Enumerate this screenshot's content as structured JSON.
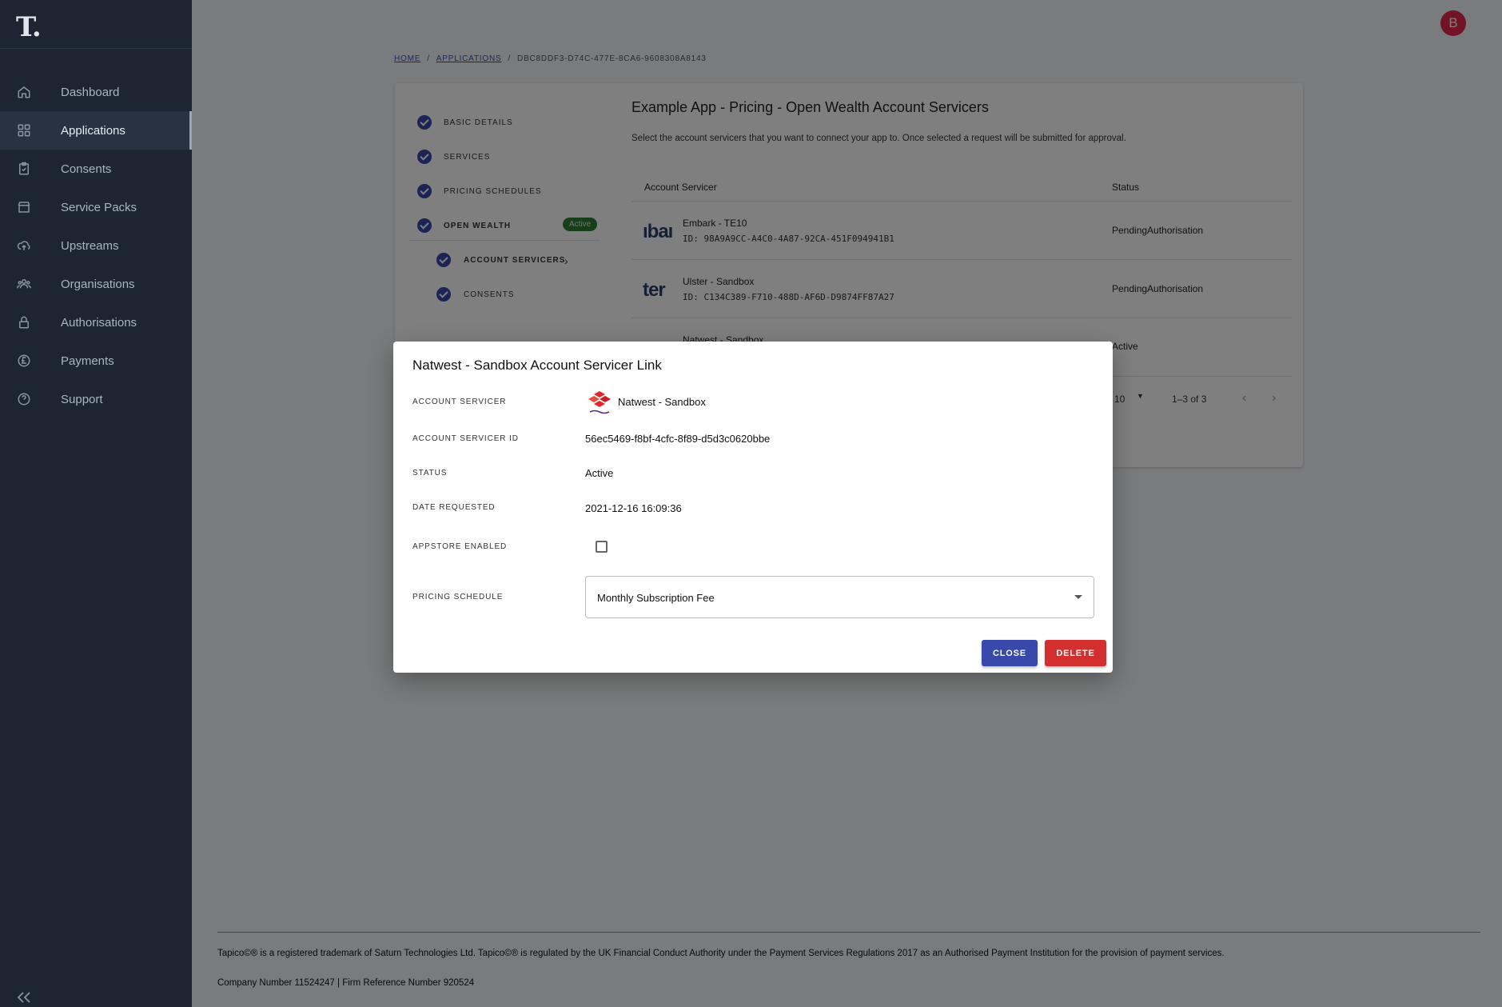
{
  "sidebar": {
    "logo": "T.",
    "items": [
      {
        "label": "Dashboard",
        "icon": "home-icon"
      },
      {
        "label": "Applications",
        "icon": "apps-grid-icon"
      },
      {
        "label": "Consents",
        "icon": "clipboard-check-icon"
      },
      {
        "label": "Service Packs",
        "icon": "store-icon"
      },
      {
        "label": "Upstreams",
        "icon": "cloud-upload-icon"
      },
      {
        "label": "Organisations",
        "icon": "groups-icon"
      },
      {
        "label": "Authorisations",
        "icon": "lock-icon"
      },
      {
        "label": "Payments",
        "icon": "pound-coin-icon"
      },
      {
        "label": "Support",
        "icon": "help-circle-icon"
      }
    ],
    "active_index": 1
  },
  "header": {
    "avatar_initial": "B",
    "avatar_color": "#e0284c"
  },
  "breadcrumb": {
    "home": "HOME",
    "applications": "APPLICATIONS",
    "current": "DBC8DDF3-D74C-477E-8CA6-9608308A8143"
  },
  "steps": {
    "items": [
      {
        "label": "BASIC DETAILS"
      },
      {
        "label": "SERVICES"
      },
      {
        "label": "PRICING SCHEDULES"
      },
      {
        "label": "OPEN WEALTH",
        "badge": "Active"
      },
      {
        "label": "ACCOUNT SERVICERS"
      },
      {
        "label": "CONSENTS"
      }
    ]
  },
  "content": {
    "title": "Example App - Pricing - Open Wealth Account Servicers",
    "description": "Select the account servicers that you want to connect your app to. Once selected a request will be submitted for approval.",
    "columns": {
      "servicer": "Account Servicer",
      "status": "Status"
    },
    "rows": [
      {
        "logo_text": "ıbaı",
        "name": "Embark - TE10",
        "id": "ID: 98A9A9CC-A4C0-4A87-92CA-451F094941B1",
        "status": "PendingAuthorisation"
      },
      {
        "logo_text": "ter",
        "name": "Ulster - Sandbox",
        "id": "ID: C134C389-F710-488D-AF6D-D9874FF87A27",
        "status": "PendingAuthorisation"
      },
      {
        "logo_text": "",
        "name": "Natwest - Sandbox",
        "id": "",
        "status": "Active"
      }
    ],
    "pager": {
      "rows_per_page": "10",
      "range": "1–3 of 3"
    }
  },
  "dialog": {
    "title": "Natwest - Sandbox Account Servicer Link",
    "labels": {
      "servicer": "ACCOUNT SERVICER",
      "servicer_id": "ACCOUNT SERVICER ID",
      "status": "STATUS",
      "date_requested": "DATE REQUESTED",
      "appstore": "APPSTORE ENABLED",
      "pricing": "PRICING SCHEDULE"
    },
    "values": {
      "servicer": "Natwest - Sandbox",
      "servicer_id": "56ec5469-f8bf-4cfc-8f89-d5d3c0620bbe",
      "status": "Active",
      "date_requested": "2021-12-16 16:09:36",
      "appstore_enabled": false,
      "pricing": "Monthly Subscription Fee"
    },
    "buttons": {
      "close": "CLOSE",
      "delete": "DELETE"
    },
    "colors": {
      "primary": "#3949ab",
      "danger": "#d32f2f",
      "natwest": "#e1252b"
    }
  },
  "footer": {
    "line1": "Tapico©® is a registered trademark of Saturn Technologies Ltd. Tapico©® is regulated by the UK Financial Conduct Authority under the Payment Services Regulations 2017 as an Authorised Payment Institution for the provision of payment services.",
    "line2": "Company Number 11524247 | Firm Reference Number 920524"
  }
}
